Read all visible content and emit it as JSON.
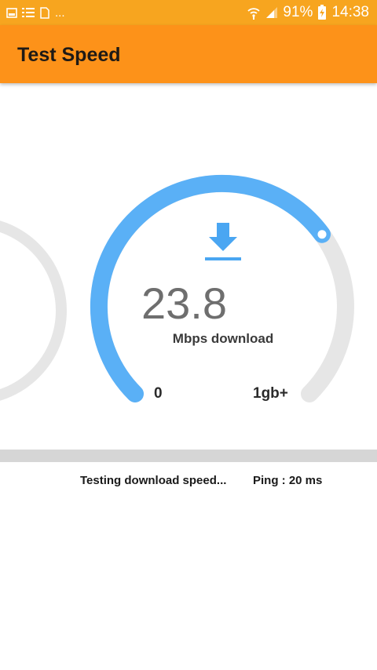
{
  "status_bar": {
    "left_icons": [
      "image-icon",
      "list-icon",
      "sim-icon"
    ],
    "more": "...",
    "battery_percent": "91%",
    "time": "14:38"
  },
  "app_bar": {
    "title": "Test Speed"
  },
  "gauge": {
    "value": "23.8",
    "unit_label": "Mbps download",
    "scale_min": "0",
    "scale_max": "1gb+",
    "fill_fraction": 0.7,
    "icon": "download-arrow-icon"
  },
  "progress": {
    "fraction": 0.0
  },
  "footer": {
    "status": "Testing download speed...",
    "ping": "Ping : 20 ms"
  },
  "colors": {
    "status_bar": "#f7a51f",
    "app_bar": "#fd9219",
    "gauge_fill": "#5ab0f6",
    "gauge_track": "#e6e6e6"
  }
}
